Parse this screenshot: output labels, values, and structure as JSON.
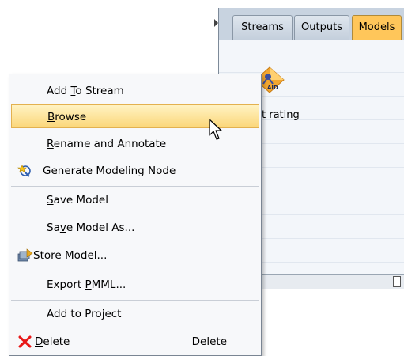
{
  "palette": {
    "tabs": [
      {
        "label": "Streams"
      },
      {
        "label": "Outputs"
      },
      {
        "label": "Models"
      }
    ],
    "active_tab": "Models",
    "model": {
      "label": "t rating",
      "icon": "chaid-model-nugget-icon",
      "badge": "AID"
    }
  },
  "context_menu": {
    "items": [
      {
        "label": "Add To Stream",
        "mnemonic": "T"
      },
      {
        "label": "Browse",
        "mnemonic": "B",
        "highlighted": true
      },
      {
        "label": "Rename and Annotate",
        "mnemonic": "R"
      },
      {
        "label": "Generate Modeling Node",
        "icon": "generate-wand-icon"
      },
      {
        "label": "Save Model",
        "mnemonic": "S"
      },
      {
        "label": "Save Model As...",
        "mnemonic": "v"
      },
      {
        "label": "Store Model...",
        "icon": "store-repository-icon"
      },
      {
        "label": "Export PMML...",
        "mnemonic": "P"
      },
      {
        "label": "Add to Project"
      },
      {
        "label": "Delete",
        "mnemonic": "D",
        "shortcut": "Delete",
        "icon": "delete-x-icon"
      }
    ]
  },
  "colors": {
    "highlight": "#fbd77a",
    "active_tab": "#ffc65a",
    "delete_icon": "#e81818"
  }
}
